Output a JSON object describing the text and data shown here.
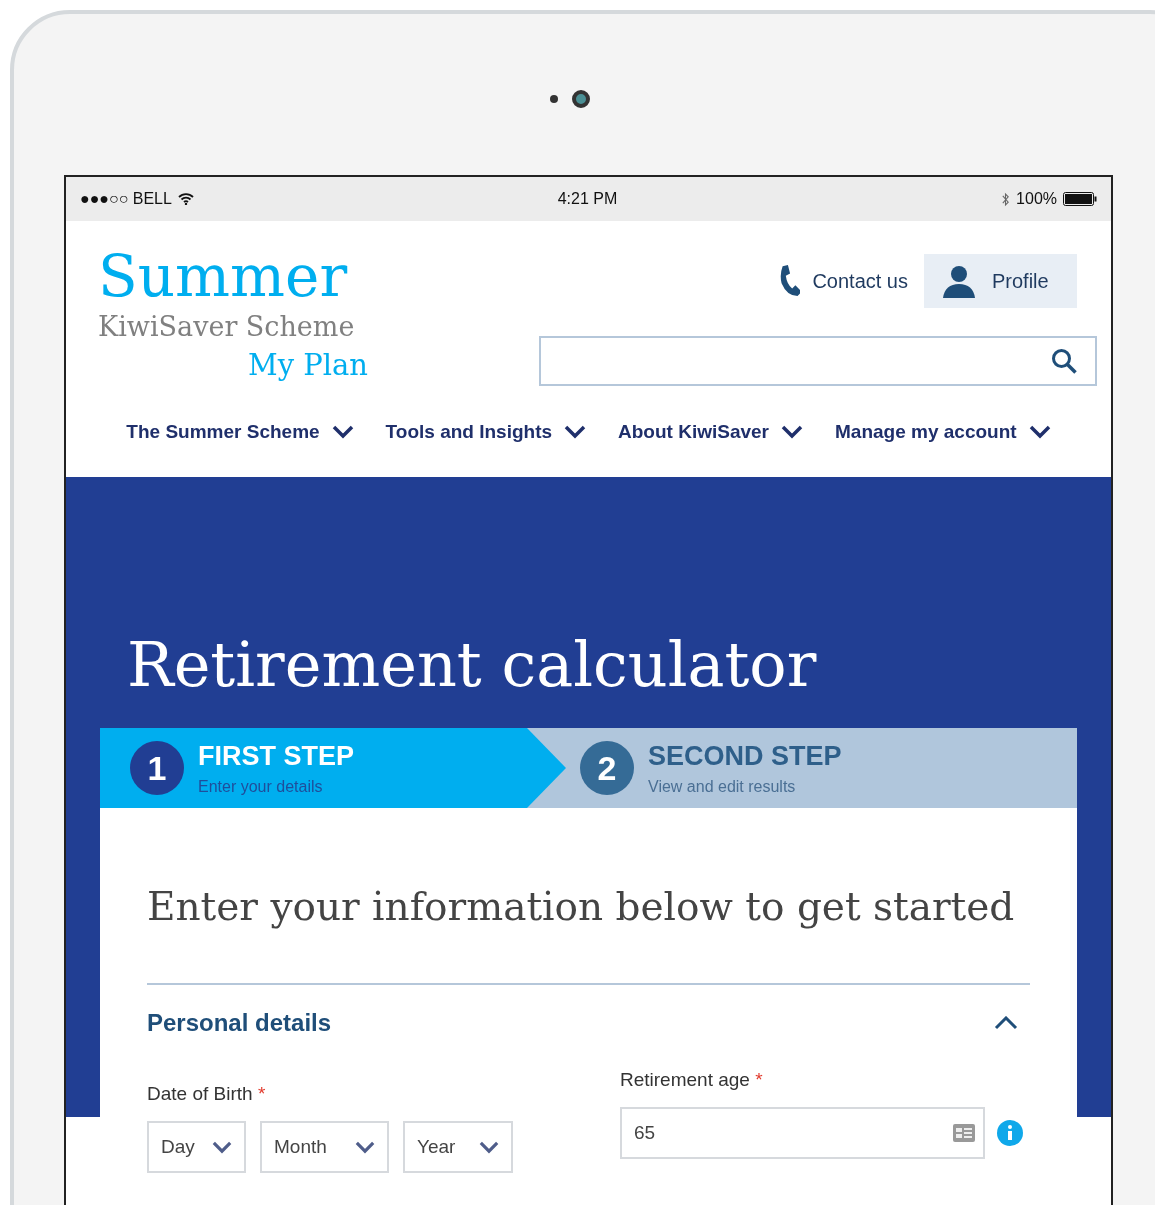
{
  "status_bar": {
    "carrier": "●●●○○ BELL",
    "time": "4:21 PM",
    "battery": "100%"
  },
  "logo": {
    "name": "Summer",
    "subtitle": "KiwiSaver Scheme",
    "plan": "My Plan"
  },
  "header_links": {
    "contact": "Contact us",
    "profile": "Profile"
  },
  "nav": [
    {
      "label": "The Summer Scheme"
    },
    {
      "label": "Tools and Insights"
    },
    {
      "label": "About KiwiSaver"
    },
    {
      "label": "Manage my account"
    }
  ],
  "title": "Retirement calculator",
  "steps": [
    {
      "number": "1",
      "title": "FIRST STEP",
      "subtitle": "Enter your details",
      "selected": true
    },
    {
      "number": "2",
      "title": "SECOND STEP",
      "subtitle": "View and edit results",
      "selected": false
    }
  ],
  "intro": "Enter your information below to get started",
  "section": {
    "title": "Personal details",
    "expanded": true
  },
  "date_of_birth": {
    "label": "Date of Birth",
    "required_mark": "*",
    "selects": [
      "Day",
      "Month",
      "Year"
    ]
  },
  "retirement_age": {
    "label": "Retirement age",
    "required_mark": "*",
    "value": "65"
  }
}
